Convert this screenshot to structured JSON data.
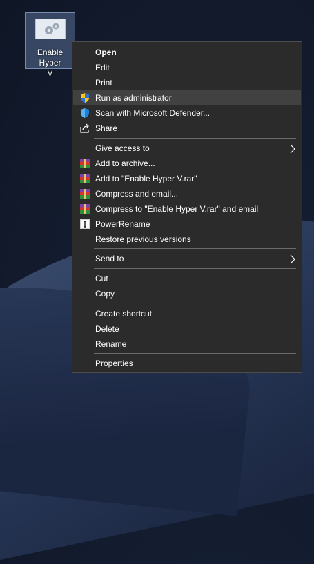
{
  "desktop": {
    "icon_label": "Enable Hyper\nV",
    "icon_name": "settings-file-icon"
  },
  "menu": {
    "items": [
      {
        "label": "Open",
        "bold": true
      },
      {
        "label": "Edit"
      },
      {
        "label": "Print"
      },
      {
        "label": "Run as administrator",
        "icon": "uac-shield-icon",
        "highlighted": true
      },
      {
        "label": "Scan with Microsoft Defender...",
        "icon": "defender-shield-icon"
      },
      {
        "label": "Share",
        "icon": "share-icon"
      },
      {
        "label": "Give access to",
        "submenu": true
      },
      {
        "label": "Add to archive...",
        "icon": "winrar-icon"
      },
      {
        "label": "Add to \"Enable Hyper V.rar\"",
        "icon": "winrar-icon"
      },
      {
        "label": "Compress and email...",
        "icon": "winrar-icon"
      },
      {
        "label": "Compress to \"Enable Hyper V.rar\" and email",
        "icon": "winrar-icon"
      },
      {
        "label": "PowerRename",
        "icon": "powerrename-icon"
      },
      {
        "label": "Restore previous versions"
      },
      {
        "label": "Send to",
        "submenu": true
      },
      {
        "label": "Cut"
      },
      {
        "label": "Copy"
      },
      {
        "label": "Create shortcut"
      },
      {
        "label": "Delete"
      },
      {
        "label": "Rename"
      },
      {
        "label": "Properties"
      }
    ]
  },
  "colors": {
    "menu_bg": "#2b2b2b",
    "highlight_bg": "#414141",
    "separator": "#6a6a6a",
    "text": "#ffffff"
  }
}
